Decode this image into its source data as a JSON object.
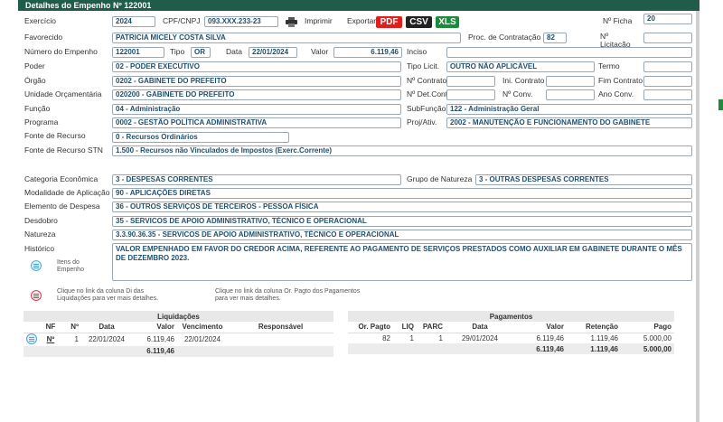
{
  "header": {
    "title": "Detalhes do Empenho Nº 122001"
  },
  "toolbar": {
    "print_label": "Imprimir",
    "export_label": "Exportar:",
    "pdf": "PDF",
    "csv": "CSV",
    "xls": "XLS"
  },
  "fields": {
    "exercicio": {
      "label": "Exercício",
      "value": "2024"
    },
    "cpf_cnpj": {
      "label": "CPF/CNPJ",
      "value": "093.XXX.233-23"
    },
    "n_ficha": {
      "label": "Nº Ficha",
      "value": "20"
    },
    "favorecido": {
      "label": "Favorecido",
      "value": "PATRICIA MICELY COSTA SILVA"
    },
    "proc_contratacao": {
      "label": "Proc. de Contratação",
      "value": "82"
    },
    "n_licitacao": {
      "label": "Nº Licitação",
      "value": ""
    },
    "numero_empenho": {
      "label": "Número do Empenho",
      "value": "122001"
    },
    "tipo": {
      "label": "Tipo",
      "value": "OR"
    },
    "data": {
      "label": "Data",
      "value": "22/01/2024"
    },
    "valor": {
      "label": "Valor",
      "value": "6.119,46"
    },
    "inciso": {
      "label": "Inciso",
      "value": ""
    },
    "poder": {
      "label": "Poder",
      "value": "02 - PODER EXECUTIVO"
    },
    "tipo_licit": {
      "label": "Tipo Licit.",
      "value": "OUTRO NÃO APLICÁVEL"
    },
    "termo": {
      "label": "Termo",
      "value": ""
    },
    "orgao": {
      "label": "Órgão",
      "value": "0202 - GABINETE DO PREFEITO"
    },
    "n_contrato": {
      "label": "Nº Contrato",
      "value": ""
    },
    "ini_contrato": {
      "label": "Ini. Contrato",
      "value": ""
    },
    "fim_contrato": {
      "label": "Fim Contrato",
      "value": ""
    },
    "unidade": {
      "label": "Unidade Orçamentária",
      "value": "020200 - GABINETE DO PREFEITO"
    },
    "n_det_cont": {
      "label": "Nº Det.Cont",
      "value": ""
    },
    "n_conv": {
      "label": "Nº Conv.",
      "value": ""
    },
    "ano_conv": {
      "label": "Ano Conv.",
      "value": ""
    },
    "funcao": {
      "label": "Função",
      "value": "04 - Administração"
    },
    "subfuncao": {
      "label": "SubFunção",
      "value": "122 - Administração Geral"
    },
    "programa": {
      "label": "Programa",
      "value": "0002 - GESTÃO POLÍTICA ADMINISTRATIVA"
    },
    "proj_ativ": {
      "label": "Proj/Ativ.",
      "value": "2002 - MANUTENÇÃO E FUNCIONAMENTO DO GABINETE"
    },
    "fonte_recurso": {
      "label": "Fonte de Recurso",
      "value": "0 - Recursos Ordinários"
    },
    "fonte_recurso_stn": {
      "label": "Fonte de Recurso STN",
      "value": "1.500 - Recursos não Vinculados de Impostos (Exerc.Corrente)"
    },
    "categoria_economica": {
      "label": "Categoria Econômica",
      "value": "3 - DESPESAS CORRENTES"
    },
    "grupo_natureza": {
      "label": "Grupo de Natureza",
      "value": "3 - OUTRAS DESPESAS CORRENTES"
    },
    "modalidade": {
      "label": "Modalidade de Aplicação",
      "value": "90 - APLICAÇÕES DIRETAS"
    },
    "elemento": {
      "label": "Elemento de Despesa",
      "value": "36 - OUTROS SERVIÇOS DE TERCEIROS - PESSOA FÍSICA"
    },
    "desdobro": {
      "label": "Desdobro",
      "value": "35 - SERVICOS DE APOIO ADMINISTRATIVO, TÉCNICO E OPERACIONAL"
    },
    "natureza": {
      "label": "Natureza",
      "value": "3.3.90.36.35 - SERVICOS DE APOIO ADMINISTRATIVO, TÉCNICO E OPERACIONAL"
    },
    "historico": {
      "label": "Histórico",
      "value": "VALOR EMPENHADO EM FAVOR DO CREDOR ACIMA, REFERENTE AO PAGAMENTO DE SERVIÇOS PRESTADOS COMO AUXILIAR EM GABINETE DURANTE O MÊS DE DEZEMBRO 2023."
    }
  },
  "legend": {
    "itens": "Itens do\nEmpenho",
    "note_di": "Clique no link da coluna Di das\nLiquidações para ver mais detalhes.",
    "note_pagto": "Clique no link da coluna Or. Pagto dos Pagamentos\npara ver mais detalhes."
  },
  "liquidacoes": {
    "title": "Liquidações",
    "columns": [
      "NF",
      "Nº",
      "Data",
      "Valor",
      "Vencimento",
      "Responsável"
    ],
    "rows": [
      [
        "Nº",
        "1",
        "22/01/2024",
        "6.119,46",
        "22/01/2024",
        ""
      ]
    ],
    "total": "6.119,46"
  },
  "pagamentos": {
    "title": "Pagamentos",
    "columns": [
      "Or. Pagto",
      "LIQ",
      "PARC",
      "Data",
      "Valor",
      "Retenção",
      "Pago"
    ],
    "rows": [
      [
        "82",
        "1",
        "1",
        "29/01/2024",
        "6.119,46",
        "1.119,46",
        "5.000,00"
      ]
    ],
    "totals": {
      "valor": "6.119,46",
      "retencao": "1.119,46",
      "pago": "5.000,00"
    }
  },
  "colors": {
    "header": "#1f5c4a",
    "value_text": "#1f4f6e",
    "pdf": "#e01e1e",
    "csv": "#222222",
    "xls": "#1e8a3c"
  }
}
